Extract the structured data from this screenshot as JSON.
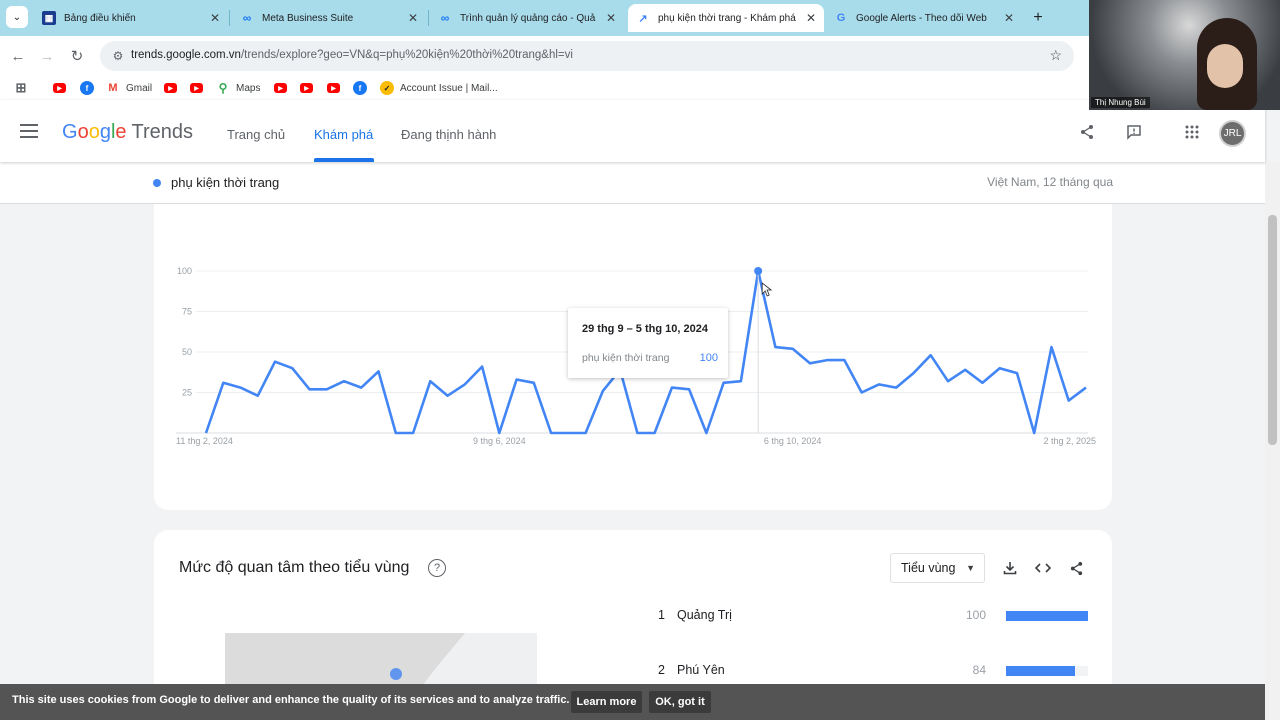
{
  "browser": {
    "tabs": [
      {
        "title": "Bảng điều khiển",
        "icon": "dashboard-icon",
        "active": false
      },
      {
        "title": "Meta Business Suite",
        "icon": "meta-icon",
        "active": false
      },
      {
        "title": "Trình quản lý quảng cáo - Quả",
        "icon": "meta-icon",
        "active": false
      },
      {
        "title": "phụ kiện thời trang - Khám phá",
        "icon": "trends-icon",
        "active": true
      },
      {
        "title": "Google Alerts - Theo dõi Web",
        "icon": "google-icon",
        "active": false
      }
    ],
    "url_host": "trends.google.com.vn",
    "url_path": "/trends/explore?geo=VN&q=phụ%20kiện%20thời%20trang&hl=vi",
    "bookmarks": [
      {
        "label": "",
        "icon": "youtube-icon"
      },
      {
        "label": "",
        "icon": "facebook-icon"
      },
      {
        "label": "Gmail",
        "icon": "gmail-icon"
      },
      {
        "label": "",
        "icon": "youtube-icon"
      },
      {
        "label": "",
        "icon": "youtube-icon"
      },
      {
        "label": "Maps",
        "icon": "maps-icon"
      },
      {
        "label": "",
        "icon": "youtube-icon"
      },
      {
        "label": "",
        "icon": "youtube-icon"
      },
      {
        "label": "",
        "icon": "youtube-icon"
      },
      {
        "label": "",
        "icon": "facebook-icon"
      },
      {
        "label": "Account Issue | Mail...",
        "icon": "norton-icon"
      }
    ]
  },
  "header": {
    "logo_google": "Google",
    "logo_trends": "Trends",
    "nav": [
      "Trang chủ",
      "Khám phá",
      "Đang thịnh hành"
    ],
    "active_nav": "Khám phá",
    "avatar_initials": "JRL"
  },
  "search": {
    "term": "phụ kiện thời trang",
    "meta": "Việt Nam, 12 tháng qua",
    "term_color": "#4285f4"
  },
  "chart_data": {
    "type": "line",
    "title": "",
    "xlabel": "",
    "ylabel": "",
    "ylim": [
      0,
      100
    ],
    "yticks": [
      25,
      50,
      75,
      100
    ],
    "xtick_labels": [
      "11 thg 2, 2024",
      "9 thg 6, 2024",
      "6 thg 10, 2024",
      "2 thg 2, 2025"
    ],
    "series": [
      {
        "name": "phụ kiện thời trang",
        "color": "#4285f4",
        "values": [
          0,
          31,
          28,
          23,
          44,
          40,
          27,
          27,
          32,
          28,
          38,
          0,
          0,
          32,
          23,
          30,
          41,
          0,
          33,
          31,
          0,
          0,
          0,
          26,
          39,
          0,
          0,
          28,
          27,
          0,
          31,
          32,
          100,
          53,
          52,
          43,
          45,
          45,
          25,
          30,
          28,
          37,
          48,
          32,
          39,
          31,
          40,
          37,
          0,
          53,
          20,
          28
        ]
      }
    ],
    "tooltip": {
      "date": "29 thg 9 – 5 thg 10, 2024",
      "series": "phụ kiện thời trang",
      "value": 100
    }
  },
  "region": {
    "title": "Mức độ quan tâm theo tiểu vùng",
    "select_label": "Tiểu vùng",
    "rows": [
      {
        "rank": "1",
        "name": "Quảng Trị",
        "value": 100
      },
      {
        "rank": "2",
        "name": "Phú Yên",
        "value": 84
      }
    ]
  },
  "cookie": {
    "message": "This site uses cookies from Google to deliver and enhance the quality of its services and to analyze traffic.",
    "learn_more": "Learn more",
    "ok": "OK, got it"
  },
  "video": {
    "participant_name": "Thị Nhung Bùi"
  }
}
